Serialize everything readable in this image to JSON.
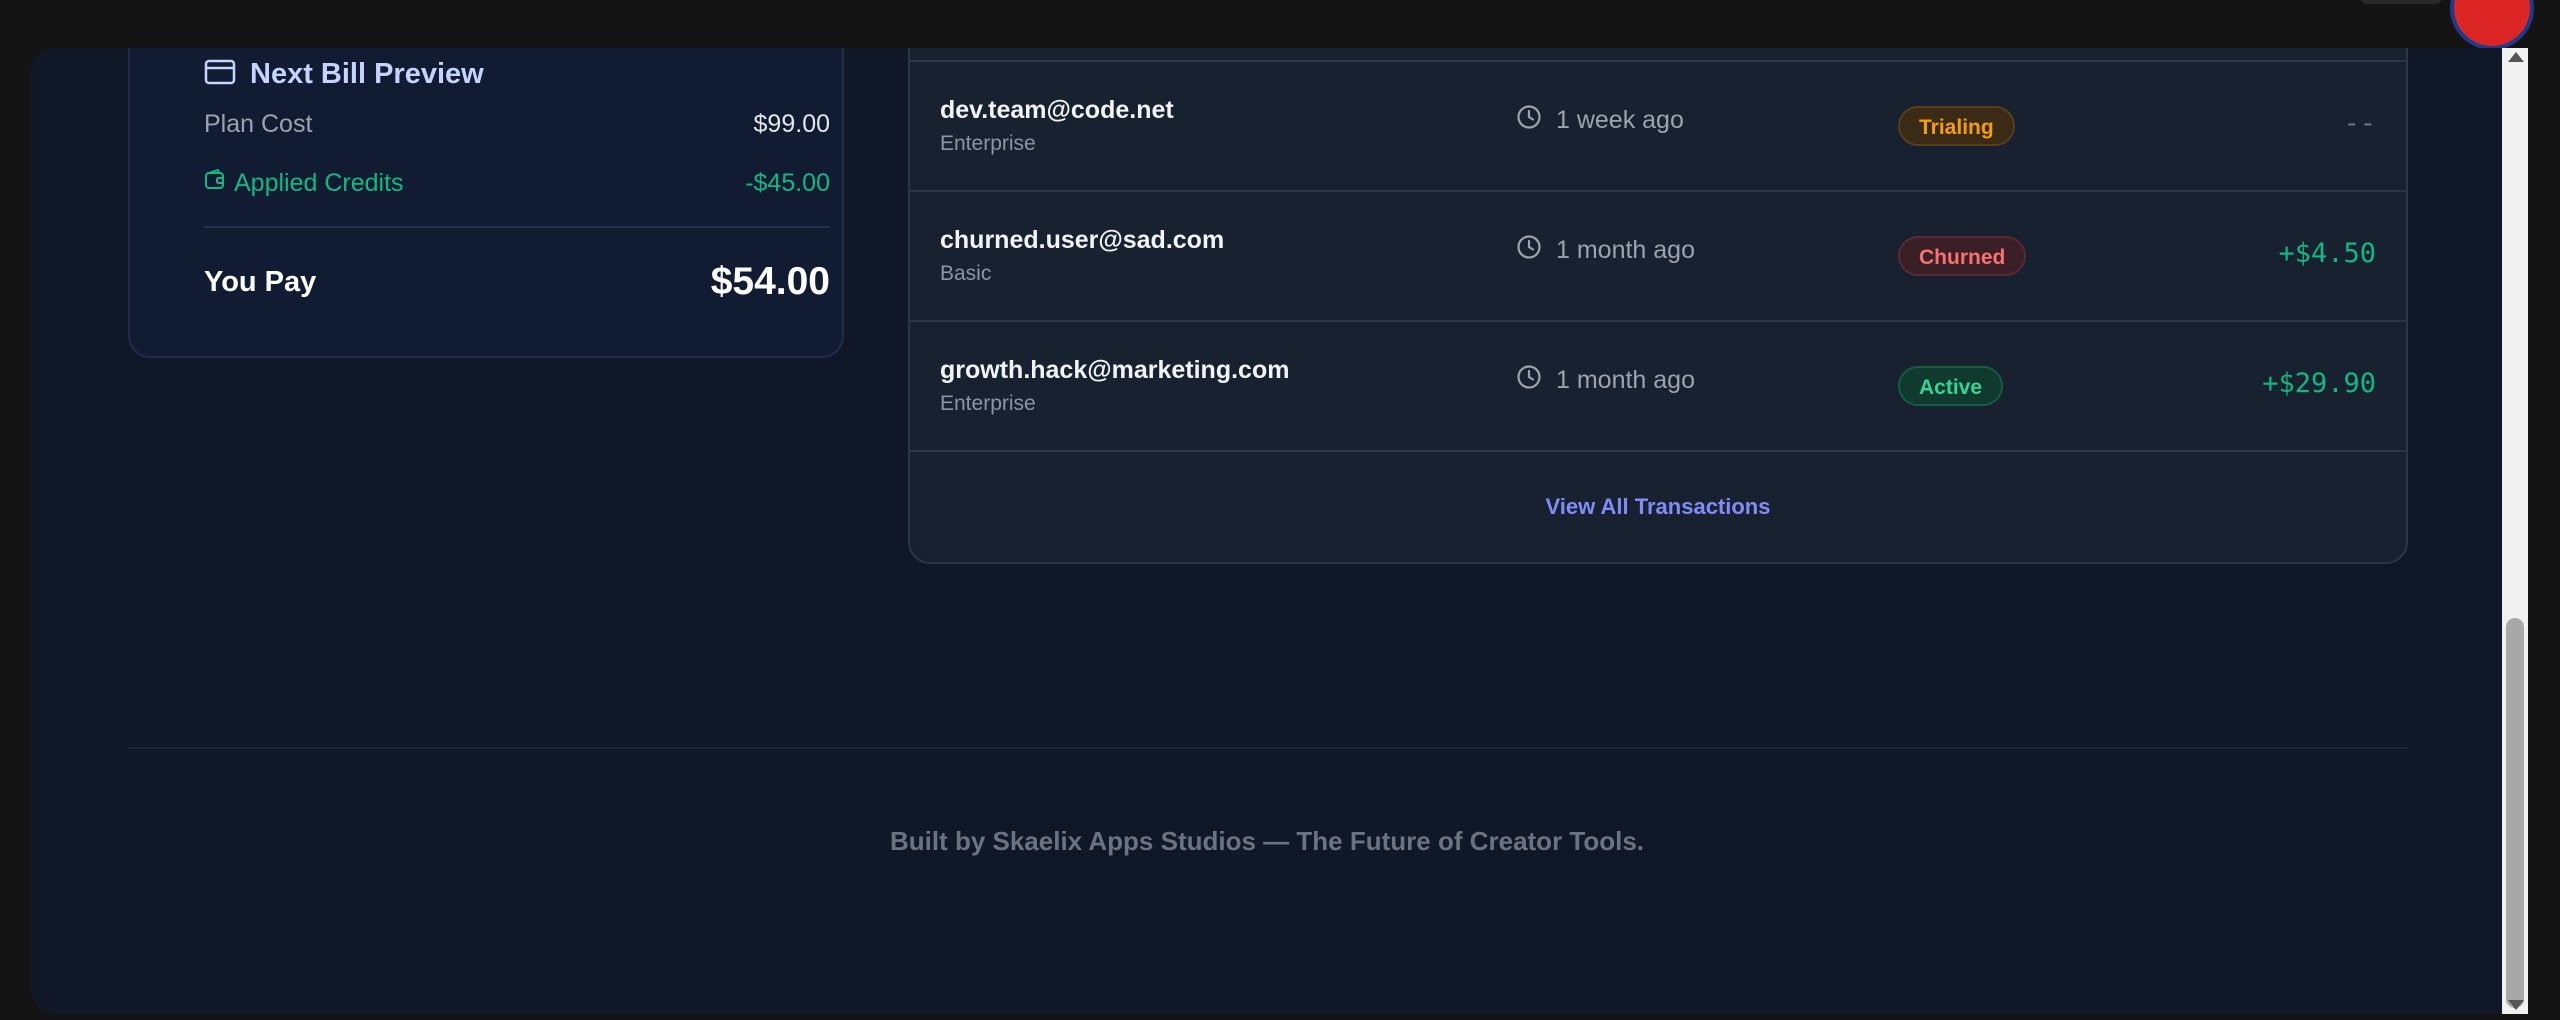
{
  "bill_preview": {
    "title": "Next Bill Preview",
    "plan_cost_label": "Plan Cost",
    "plan_cost_value": "$99.00",
    "credits_label": "Applied Credits",
    "credits_value": "-$45.00",
    "you_pay_label": "You Pay",
    "you_pay_value": "$54.00",
    "icons": {
      "title": "credit-card-icon",
      "credits": "wallet-icon"
    }
  },
  "transactions": {
    "rows": [
      {
        "email": "dev.team@code.net",
        "plan": "Enterprise",
        "time": "1 week ago",
        "status": "Trialing",
        "amount": "--"
      },
      {
        "email": "churned.user@sad.com",
        "plan": "Basic",
        "time": "1 month ago",
        "status": "Churned",
        "amount": "+$4.50"
      },
      {
        "email": "growth.hack@marketing.com",
        "plan": "Enterprise",
        "time": "1 month ago",
        "status": "Active",
        "amount": "+$29.90"
      }
    ],
    "view_all_label": "View All Transactions"
  },
  "footer": {
    "text": "Built by Skaelix Apps Studios — The Future of Creator Tools."
  },
  "colors": {
    "background": "#101827",
    "accent": "#818cf8",
    "positive": "#10b981",
    "trialing": "#f59e0b",
    "churned": "#f87171"
  }
}
